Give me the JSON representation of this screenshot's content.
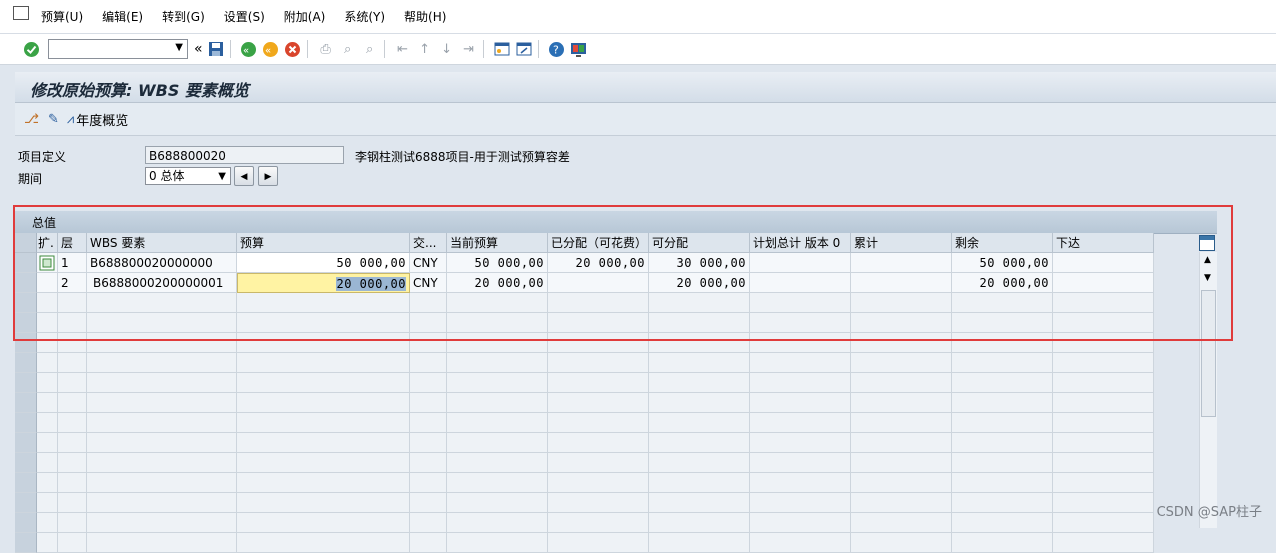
{
  "menu": {
    "items": [
      "预算(U)",
      "编辑(E)",
      "转到(G)",
      "设置(S)",
      "附加(A)",
      "系统(Y)",
      "帮助(H)"
    ]
  },
  "toolbar": {
    "command_value": "",
    "back_label": "«"
  },
  "title": "修改原始预算: WBS 要素概览",
  "app_toolbar": {
    "annual_overview": "年度概览"
  },
  "header": {
    "project_label": "项目定义",
    "project_value": "B688800020",
    "project_desc": "李钢柱测试6888项目-用于测试预算容差",
    "period_label": "期间",
    "period_value": "0 总体"
  },
  "grid": {
    "title": "总值",
    "columns": [
      "扩.",
      "层",
      "WBS 要素",
      "预算",
      "交...",
      "当前预算",
      "已分配（可花费）",
      "可分配",
      "计划总计 版本 0",
      "累计",
      "剩余",
      "下达"
    ],
    "rows": [
      {
        "level": "1",
        "wbs": "B688800020000000",
        "budget": "50 000,00",
        "currency": "CNY",
        "current_budget": "50 000,00",
        "assigned": "20 000,00",
        "distributable": "30 000,00",
        "plan_total": "",
        "cumulative": "",
        "remaining": "50 000,00",
        "released": ""
      },
      {
        "level": "2",
        "wbs": "B6888000200000001",
        "budget": "20 000,00",
        "currency": "CNY",
        "current_budget": "20 000,00",
        "assigned": "",
        "distributable": "20 000,00",
        "plan_total": "",
        "cumulative": "",
        "remaining": "20 000,00",
        "released": ""
      }
    ]
  },
  "watermark": "CSDN @SAP柱子"
}
